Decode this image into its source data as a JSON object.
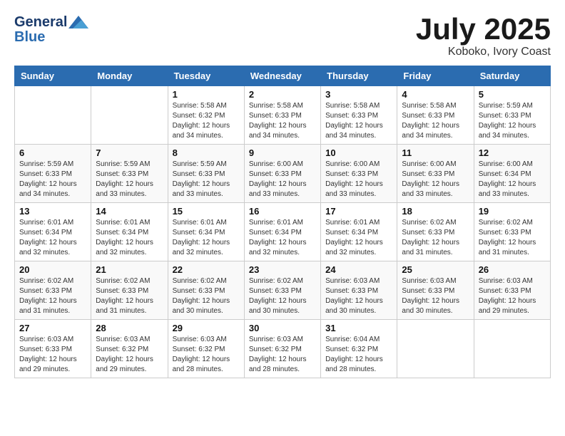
{
  "header": {
    "logo_line1": "General",
    "logo_line2": "Blue",
    "month_title": "July 2025",
    "location": "Koboko, Ivory Coast"
  },
  "days_of_week": [
    "Sunday",
    "Monday",
    "Tuesday",
    "Wednesday",
    "Thursday",
    "Friday",
    "Saturday"
  ],
  "weeks": [
    [
      {
        "day": "",
        "sunrise": "",
        "sunset": "",
        "daylight": ""
      },
      {
        "day": "",
        "sunrise": "",
        "sunset": "",
        "daylight": ""
      },
      {
        "day": "1",
        "sunrise": "Sunrise: 5:58 AM",
        "sunset": "Sunset: 6:32 PM",
        "daylight": "Daylight: 12 hours and 34 minutes."
      },
      {
        "day": "2",
        "sunrise": "Sunrise: 5:58 AM",
        "sunset": "Sunset: 6:33 PM",
        "daylight": "Daylight: 12 hours and 34 minutes."
      },
      {
        "day": "3",
        "sunrise": "Sunrise: 5:58 AM",
        "sunset": "Sunset: 6:33 PM",
        "daylight": "Daylight: 12 hours and 34 minutes."
      },
      {
        "day": "4",
        "sunrise": "Sunrise: 5:58 AM",
        "sunset": "Sunset: 6:33 PM",
        "daylight": "Daylight: 12 hours and 34 minutes."
      },
      {
        "day": "5",
        "sunrise": "Sunrise: 5:59 AM",
        "sunset": "Sunset: 6:33 PM",
        "daylight": "Daylight: 12 hours and 34 minutes."
      }
    ],
    [
      {
        "day": "6",
        "sunrise": "Sunrise: 5:59 AM",
        "sunset": "Sunset: 6:33 PM",
        "daylight": "Daylight: 12 hours and 34 minutes."
      },
      {
        "day": "7",
        "sunrise": "Sunrise: 5:59 AM",
        "sunset": "Sunset: 6:33 PM",
        "daylight": "Daylight: 12 hours and 33 minutes."
      },
      {
        "day": "8",
        "sunrise": "Sunrise: 5:59 AM",
        "sunset": "Sunset: 6:33 PM",
        "daylight": "Daylight: 12 hours and 33 minutes."
      },
      {
        "day": "9",
        "sunrise": "Sunrise: 6:00 AM",
        "sunset": "Sunset: 6:33 PM",
        "daylight": "Daylight: 12 hours and 33 minutes."
      },
      {
        "day": "10",
        "sunrise": "Sunrise: 6:00 AM",
        "sunset": "Sunset: 6:33 PM",
        "daylight": "Daylight: 12 hours and 33 minutes."
      },
      {
        "day": "11",
        "sunrise": "Sunrise: 6:00 AM",
        "sunset": "Sunset: 6:33 PM",
        "daylight": "Daylight: 12 hours and 33 minutes."
      },
      {
        "day": "12",
        "sunrise": "Sunrise: 6:00 AM",
        "sunset": "Sunset: 6:34 PM",
        "daylight": "Daylight: 12 hours and 33 minutes."
      }
    ],
    [
      {
        "day": "13",
        "sunrise": "Sunrise: 6:01 AM",
        "sunset": "Sunset: 6:34 PM",
        "daylight": "Daylight: 12 hours and 32 minutes."
      },
      {
        "day": "14",
        "sunrise": "Sunrise: 6:01 AM",
        "sunset": "Sunset: 6:34 PM",
        "daylight": "Daylight: 12 hours and 32 minutes."
      },
      {
        "day": "15",
        "sunrise": "Sunrise: 6:01 AM",
        "sunset": "Sunset: 6:34 PM",
        "daylight": "Daylight: 12 hours and 32 minutes."
      },
      {
        "day": "16",
        "sunrise": "Sunrise: 6:01 AM",
        "sunset": "Sunset: 6:34 PM",
        "daylight": "Daylight: 12 hours and 32 minutes."
      },
      {
        "day": "17",
        "sunrise": "Sunrise: 6:01 AM",
        "sunset": "Sunset: 6:34 PM",
        "daylight": "Daylight: 12 hours and 32 minutes."
      },
      {
        "day": "18",
        "sunrise": "Sunrise: 6:02 AM",
        "sunset": "Sunset: 6:33 PM",
        "daylight": "Daylight: 12 hours and 31 minutes."
      },
      {
        "day": "19",
        "sunrise": "Sunrise: 6:02 AM",
        "sunset": "Sunset: 6:33 PM",
        "daylight": "Daylight: 12 hours and 31 minutes."
      }
    ],
    [
      {
        "day": "20",
        "sunrise": "Sunrise: 6:02 AM",
        "sunset": "Sunset: 6:33 PM",
        "daylight": "Daylight: 12 hours and 31 minutes."
      },
      {
        "day": "21",
        "sunrise": "Sunrise: 6:02 AM",
        "sunset": "Sunset: 6:33 PM",
        "daylight": "Daylight: 12 hours and 31 minutes."
      },
      {
        "day": "22",
        "sunrise": "Sunrise: 6:02 AM",
        "sunset": "Sunset: 6:33 PM",
        "daylight": "Daylight: 12 hours and 30 minutes."
      },
      {
        "day": "23",
        "sunrise": "Sunrise: 6:02 AM",
        "sunset": "Sunset: 6:33 PM",
        "daylight": "Daylight: 12 hours and 30 minutes."
      },
      {
        "day": "24",
        "sunrise": "Sunrise: 6:03 AM",
        "sunset": "Sunset: 6:33 PM",
        "daylight": "Daylight: 12 hours and 30 minutes."
      },
      {
        "day": "25",
        "sunrise": "Sunrise: 6:03 AM",
        "sunset": "Sunset: 6:33 PM",
        "daylight": "Daylight: 12 hours and 30 minutes."
      },
      {
        "day": "26",
        "sunrise": "Sunrise: 6:03 AM",
        "sunset": "Sunset: 6:33 PM",
        "daylight": "Daylight: 12 hours and 29 minutes."
      }
    ],
    [
      {
        "day": "27",
        "sunrise": "Sunrise: 6:03 AM",
        "sunset": "Sunset: 6:33 PM",
        "daylight": "Daylight: 12 hours and 29 minutes."
      },
      {
        "day": "28",
        "sunrise": "Sunrise: 6:03 AM",
        "sunset": "Sunset: 6:32 PM",
        "daylight": "Daylight: 12 hours and 29 minutes."
      },
      {
        "day": "29",
        "sunrise": "Sunrise: 6:03 AM",
        "sunset": "Sunset: 6:32 PM",
        "daylight": "Daylight: 12 hours and 28 minutes."
      },
      {
        "day": "30",
        "sunrise": "Sunrise: 6:03 AM",
        "sunset": "Sunset: 6:32 PM",
        "daylight": "Daylight: 12 hours and 28 minutes."
      },
      {
        "day": "31",
        "sunrise": "Sunrise: 6:04 AM",
        "sunset": "Sunset: 6:32 PM",
        "daylight": "Daylight: 12 hours and 28 minutes."
      },
      {
        "day": "",
        "sunrise": "",
        "sunset": "",
        "daylight": ""
      },
      {
        "day": "",
        "sunrise": "",
        "sunset": "",
        "daylight": ""
      }
    ]
  ]
}
